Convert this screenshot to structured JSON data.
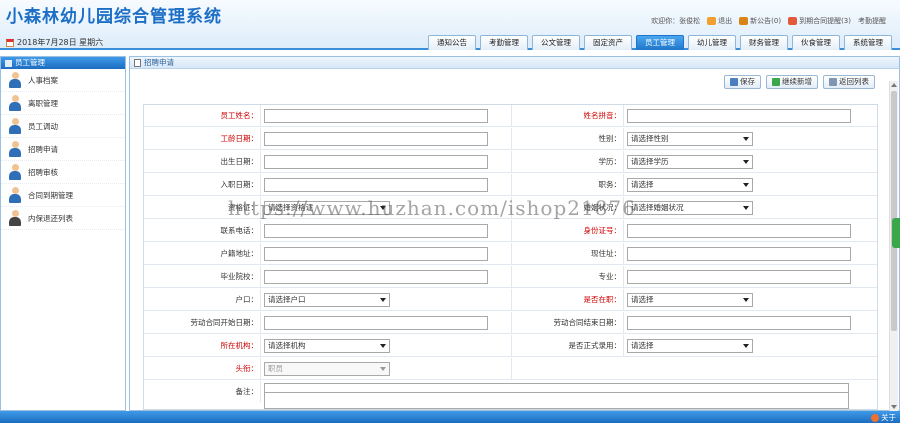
{
  "app": {
    "title": "小森林幼儿园综合管理系统",
    "date": "2018年7月28日 星期六"
  },
  "top_links": [
    "欢迎你：张俊松",
    "退出",
    "新公告(0)",
    "到期合同提醒(3)",
    "考勤提醒"
  ],
  "tabs": [
    "通知公告",
    "考勤管理",
    "公文管理",
    "固定资产",
    "员工管理",
    "幼儿管理",
    "财务管理",
    "伙食管理",
    "系统管理"
  ],
  "active_tab": "员工管理",
  "sidebar": {
    "title": "员工管理",
    "items": [
      "人事档案",
      "离职管理",
      "员工调动",
      "招聘申请",
      "招聘审核",
      "合同到期管理",
      "内保退还列表"
    ]
  },
  "breadcrumb": "招聘申请",
  "toolbar": {
    "save": "保存",
    "continue_add": "继续新增",
    "back_list": "返回列表"
  },
  "form": {
    "rows": [
      {
        "left": {
          "label": "员工姓名：",
          "req": true,
          "type": "input",
          "value": ""
        },
        "right": {
          "label": "姓名拼音：",
          "req": true,
          "type": "input",
          "value": ""
        }
      },
      {
        "left": {
          "label": "工龄日期：",
          "req": true,
          "type": "input",
          "value": ""
        },
        "right": {
          "label": "性别：",
          "req": false,
          "type": "select",
          "value": "请选择性别"
        }
      },
      {
        "left": {
          "label": "出生日期：",
          "req": false,
          "type": "input",
          "value": ""
        },
        "right": {
          "label": "学历：",
          "req": false,
          "type": "select",
          "value": "请选择学历"
        }
      },
      {
        "left": {
          "label": "入职日期：",
          "req": false,
          "type": "input",
          "value": ""
        },
        "right": {
          "label": "职务：",
          "req": false,
          "type": "select",
          "value": "请选择"
        }
      },
      {
        "left": {
          "label": "资格证：",
          "req": false,
          "type": "select",
          "value": "请选择资格证"
        },
        "right": {
          "label": "婚姻状况：",
          "req": false,
          "type": "select",
          "value": "请选择婚姻状况"
        }
      },
      {
        "left": {
          "label": "联系电话：",
          "req": false,
          "type": "input",
          "value": ""
        },
        "right": {
          "label": "身份证号：",
          "req": true,
          "type": "input",
          "value": ""
        }
      },
      {
        "left": {
          "label": "户籍地址：",
          "req": false,
          "type": "input",
          "value": ""
        },
        "right": {
          "label": "现住址：",
          "req": false,
          "type": "input",
          "value": ""
        }
      },
      {
        "left": {
          "label": "毕业院校：",
          "req": false,
          "type": "input",
          "value": ""
        },
        "right": {
          "label": "专业：",
          "req": false,
          "type": "input",
          "value": ""
        }
      },
      {
        "left": {
          "label": "户口：",
          "req": false,
          "type": "select",
          "value": "请选择户口"
        },
        "right": {
          "label": "是否在职：",
          "req": true,
          "type": "select",
          "value": "请选择"
        }
      },
      {
        "left": {
          "label": "劳动合同开始日期：",
          "req": false,
          "type": "input",
          "value": ""
        },
        "right": {
          "label": "劳动合同结束日期：",
          "req": false,
          "type": "input",
          "value": ""
        }
      },
      {
        "left": {
          "label": "所在机构：",
          "req": true,
          "type": "select",
          "value": "请选择机构"
        },
        "right": {
          "label": "是否正式录用：",
          "req": false,
          "type": "select",
          "value": "请选择"
        }
      },
      {
        "left": {
          "label": "头衔：",
          "req": true,
          "type": "select",
          "value": "职员",
          "disabled": true
        },
        "right": null
      }
    ],
    "remark_label": "备注："
  },
  "footer": {
    "about": "关于"
  },
  "watermark": "https://www.huzhan.com/ishop21876"
}
